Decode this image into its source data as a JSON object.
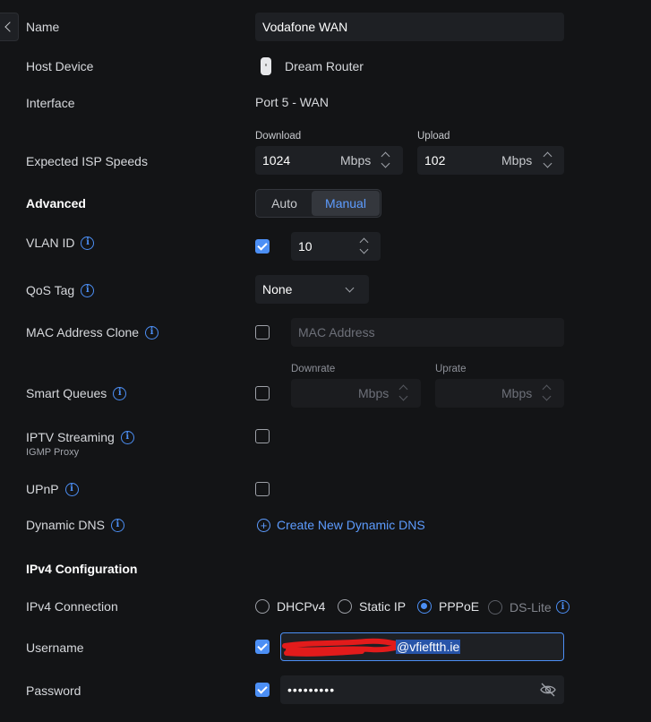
{
  "colors": {
    "accent": "#4c8ff5",
    "background": "#131416",
    "field": "#1e2024"
  },
  "name": {
    "label": "Name",
    "value": "Vodafone WAN"
  },
  "host_device": {
    "label": "Host Device",
    "value": "Dream Router",
    "icon": "router-icon"
  },
  "interface": {
    "label": "Interface",
    "value": "Port 5 - WAN"
  },
  "isp_speeds": {
    "label": "Expected ISP Speeds",
    "download": {
      "caption": "Download",
      "value": "1024",
      "unit": "Mbps"
    },
    "upload": {
      "caption": "Upload",
      "value": "102",
      "unit": "Mbps"
    }
  },
  "advanced": {
    "label": "Advanced",
    "options": [
      "Auto",
      "Manual"
    ],
    "selected": "Manual"
  },
  "vlan": {
    "label": "VLAN ID",
    "checked": true,
    "value": "10"
  },
  "qos": {
    "label": "QoS Tag",
    "value": "None"
  },
  "mac_clone": {
    "label": "MAC Address Clone",
    "checked": false,
    "placeholder": "MAC Address"
  },
  "smart_queues": {
    "label": "Smart Queues",
    "checked": false,
    "downrate": {
      "caption": "Downrate",
      "unit": "Mbps"
    },
    "uprate": {
      "caption": "Uprate",
      "unit": "Mbps"
    }
  },
  "iptv": {
    "label": "IPTV Streaming",
    "sublabel": "IGMP Proxy",
    "checked": false
  },
  "upnp": {
    "label": "UPnP",
    "checked": false
  },
  "dynamic_dns": {
    "label": "Dynamic DNS",
    "action": "Create New Dynamic DNS"
  },
  "ipv4": {
    "section": "IPv4 Configuration",
    "connection_label": "IPv4 Connection",
    "options": [
      "DHCPv4",
      "Static IP",
      "PPPoE",
      "DS-Lite"
    ],
    "selected": "PPPoE"
  },
  "username": {
    "label": "Username",
    "checked": true,
    "value_visible": "@vfieftth.ie"
  },
  "password": {
    "label": "Password",
    "checked": true,
    "masked": "•••••••••"
  }
}
